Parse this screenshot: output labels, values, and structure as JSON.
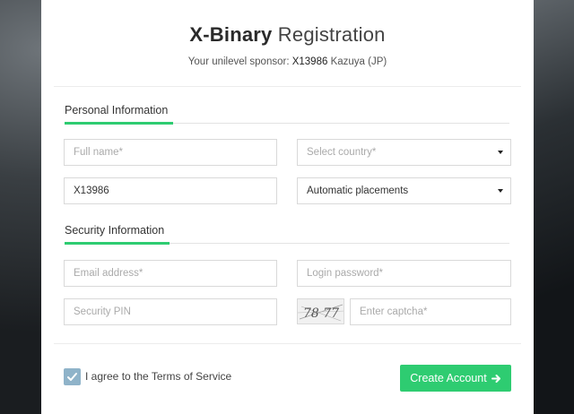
{
  "modal": {
    "title_bold": "X-Binary",
    "title_rest": "Registration",
    "sponsor_prefix": "Your unilevel sponsor:",
    "sponsor_code": "X13986",
    "sponsor_name": "Kazuya (JP)"
  },
  "personal": {
    "heading": "Personal Information",
    "full_name_placeholder": "Full name*",
    "country_placeholder": "Select country*",
    "sponsor_value": "X13986",
    "placement_value": "Automatic placements"
  },
  "security": {
    "heading": "Security Information",
    "email_placeholder": "Email address*",
    "password_placeholder": "Login password*",
    "pin_placeholder": "Security PIN",
    "captcha_placeholder": "Enter captcha*",
    "captcha_text": "78 77"
  },
  "footer": {
    "agree_label": "I agree to the Terms of Service",
    "agree_checked": true,
    "create_label": "Create Account",
    "create_icon": "arrow-right-icon"
  },
  "colors": {
    "accent": "#2ecc71",
    "checkbox": "#8fb3c9"
  }
}
